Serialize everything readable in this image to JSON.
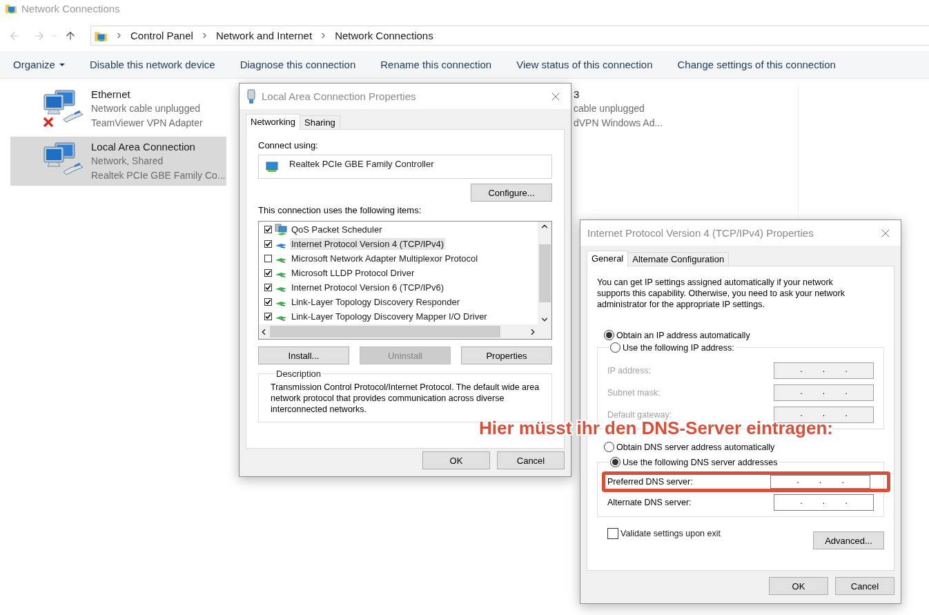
{
  "window": {
    "title": "Network Connections"
  },
  "address_bar": {
    "path": [
      "Control Panel",
      "Network and Internet",
      "Network Connections"
    ]
  },
  "command_bar": [
    {
      "label": "Organize",
      "kind": "menu"
    },
    {
      "label": "Disable this network device",
      "kind": "action"
    },
    {
      "label": "Diagnose this connection",
      "kind": "action"
    },
    {
      "label": "Rename this connection",
      "kind": "action"
    },
    {
      "label": "View status of this connection",
      "kind": "action"
    },
    {
      "label": "Change settings of this connection",
      "kind": "action"
    }
  ],
  "connections": [
    {
      "name": "Ethernet",
      "status": "Network cable unplugged",
      "adapter": "TeamViewer VPN Adapter",
      "selected": false,
      "disconnected": true
    },
    {
      "name": "Local Area Connection",
      "status": "Network, Shared",
      "adapter": "Realtek PCIe GBE Family Co...",
      "selected": true,
      "disconnected": false
    }
  ],
  "partly_hidden_connection": {
    "name": "3",
    "status": "cable unplugged",
    "adapter": "dVPN Windows Ad..."
  },
  "properties_dialog": {
    "title": "Local Area Connection Properties",
    "tabs": [
      {
        "label": "Networking",
        "selected": true
      },
      {
        "label": "Sharing",
        "selected": false
      }
    ],
    "connect_using_label": "Connect using:",
    "adapter": "Realtek PCIe GBE Family Controller",
    "configure_button": "Configure...",
    "items_label": "This connection uses the following items:",
    "items": [
      {
        "label": "QoS Packet Scheduler",
        "kind": "service",
        "checked": true,
        "selected": false
      },
      {
        "label": "Internet Protocol Version 4 (TCP/IPv4)",
        "kind": "protocol",
        "checked": true,
        "selected": true
      },
      {
        "label": "Microsoft Network Adapter Multiplexor Protocol",
        "kind": "protocol",
        "checked": false,
        "selected": false
      },
      {
        "label": "Microsoft LLDP Protocol Driver",
        "kind": "protocol",
        "checked": true,
        "selected": false
      },
      {
        "label": "Internet Protocol Version 6 (TCP/IPv6)",
        "kind": "protocol",
        "checked": true,
        "selected": false
      },
      {
        "label": "Link-Layer Topology Discovery Responder",
        "kind": "protocol",
        "checked": true,
        "selected": false
      },
      {
        "label": "Link-Layer Topology Discovery Mapper I/O Driver",
        "kind": "protocol",
        "checked": true,
        "selected": false
      }
    ],
    "buttons": [
      {
        "label": "Install...",
        "disabled": false
      },
      {
        "label": "Uninstall",
        "disabled": true
      },
      {
        "label": "Properties",
        "disabled": false
      }
    ],
    "description": {
      "legend": "Description",
      "text": "Transmission Control Protocol/Internet Protocol. The default wide area network protocol that provides communication across diverse interconnected networks."
    },
    "footer_buttons": [
      "OK",
      "Cancel"
    ]
  },
  "ipv4_dialog": {
    "title": "Internet Protocol Version 4 (TCP/IPv4) Properties",
    "tabs": [
      {
        "label": "General",
        "selected": true
      },
      {
        "label": "Alternate Configuration",
        "selected": false
      }
    ],
    "intro": "You can get IP settings assigned automatically if your network supports this capability. Otherwise, you need to ask your network administrator for the appropriate IP settings.",
    "ip_auto": {
      "label": "Obtain an IP address automatically",
      "selected": true
    },
    "ip_manual": {
      "label": "Use the following IP address:",
      "selected": false
    },
    "ip_fields": [
      {
        "label": "IP address:",
        "value": ". . .",
        "disabled": true
      },
      {
        "label": "Subnet mask:",
        "value": ". . .",
        "disabled": true
      },
      {
        "label": "Default gateway:",
        "value": ". . .",
        "disabled": true
      }
    ],
    "dns_auto": {
      "label": "Obtain DNS server address automatically",
      "selected": false
    },
    "dns_manual": {
      "label": "Use the following DNS server addresses",
      "selected": true
    },
    "dns_fields": [
      {
        "label": "Preferred DNS server:",
        "value": ". . .",
        "disabled": false,
        "highlighted": true
      },
      {
        "label": "Alternate DNS server:",
        "value": ". . .",
        "disabled": false,
        "highlighted": false
      }
    ],
    "validate": {
      "label": "Validate settings upon exit",
      "checked": false
    },
    "advanced_button": "Advanced...",
    "footer_buttons": [
      "OK",
      "Cancel"
    ]
  },
  "annotation": {
    "text": "Hier müsst ihr den DNS-Server eintragen:"
  }
}
